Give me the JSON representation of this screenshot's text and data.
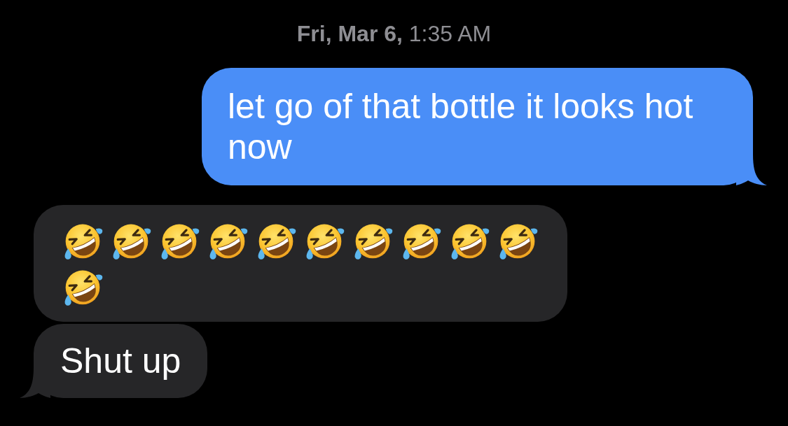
{
  "timestamp": "**Fri, Mar 6,** 1:35 AM",
  "messages": [
    {
      "kind": "sent",
      "text": "let go of that bottle it looks hot now",
      "tail": true
    },
    {
      "kind": "received",
      "emojis": [
        {
          "kind": "rofl"
        },
        {
          "kind": "rofl"
        },
        {
          "kind": "rofl"
        },
        {
          "kind": "rofl"
        },
        {
          "kind": "rofl"
        },
        {
          "kind": "rofl"
        },
        {
          "kind": "rofl"
        },
        {
          "kind": "rofl"
        },
        {
          "kind": "rofl"
        },
        {
          "kind": "rofl"
        },
        {
          "kind": "rofl"
        }
      ],
      "tail": false
    },
    {
      "kind": "received",
      "text": "Shut up",
      "tail": true
    }
  ]
}
